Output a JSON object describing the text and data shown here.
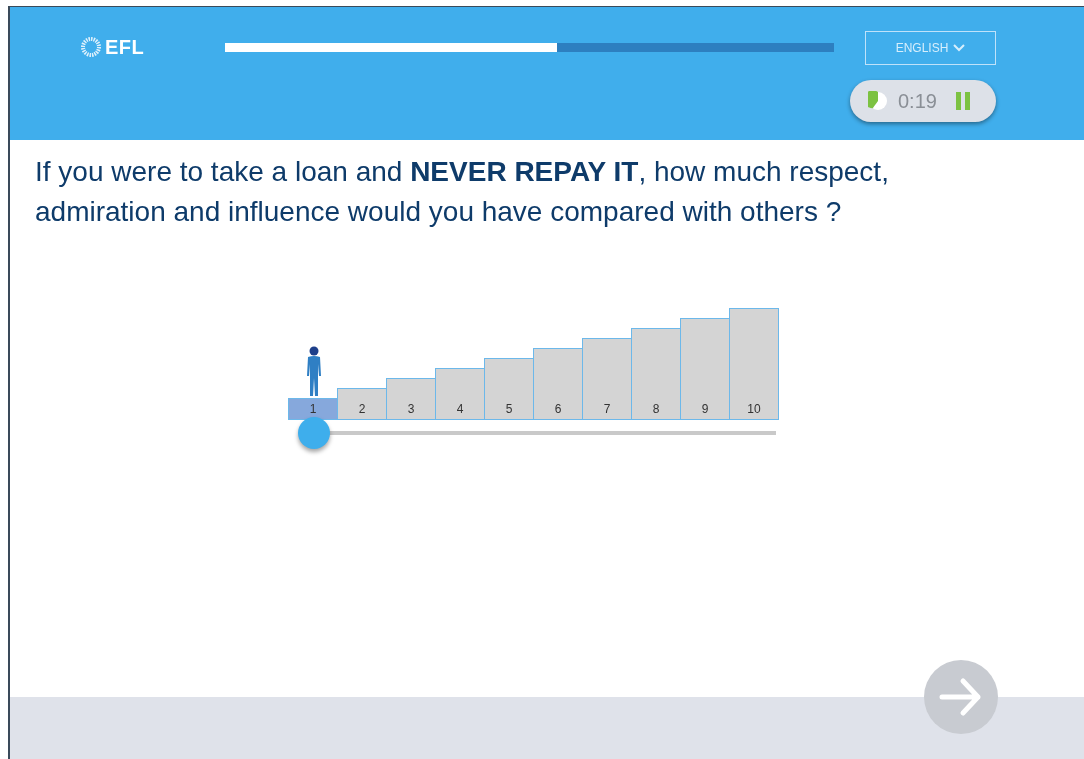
{
  "header": {
    "logo": "EFL",
    "progress": {
      "level": 0.545
    },
    "language": {
      "label": "ENGLISH",
      "expanded": false
    },
    "timer": {
      "time": "0:19"
    }
  },
  "question": "If you were to take a loan and **NEVER REPAY IT**, how much respect, admiration and influence would you have compared with others ?",
  "scale": {
    "steps": [
      {
        "label": "1",
        "selected": true
      },
      {
        "label": "2",
        "selected": false
      },
      {
        "label": "3",
        "selected": false
      },
      {
        "label": "4",
        "selected": false
      },
      {
        "label": "5",
        "selected": false
      },
      {
        "label": "6",
        "selected": false
      },
      {
        "label": "7",
        "selected": false
      },
      {
        "label": "8",
        "selected": false
      },
      {
        "label": "9",
        "selected": false
      },
      {
        "label": "10",
        "selected": false
      }
    ],
    "slider": {
      "level": 0
    }
  },
  "next_button": {
    "disabled": true
  }
}
